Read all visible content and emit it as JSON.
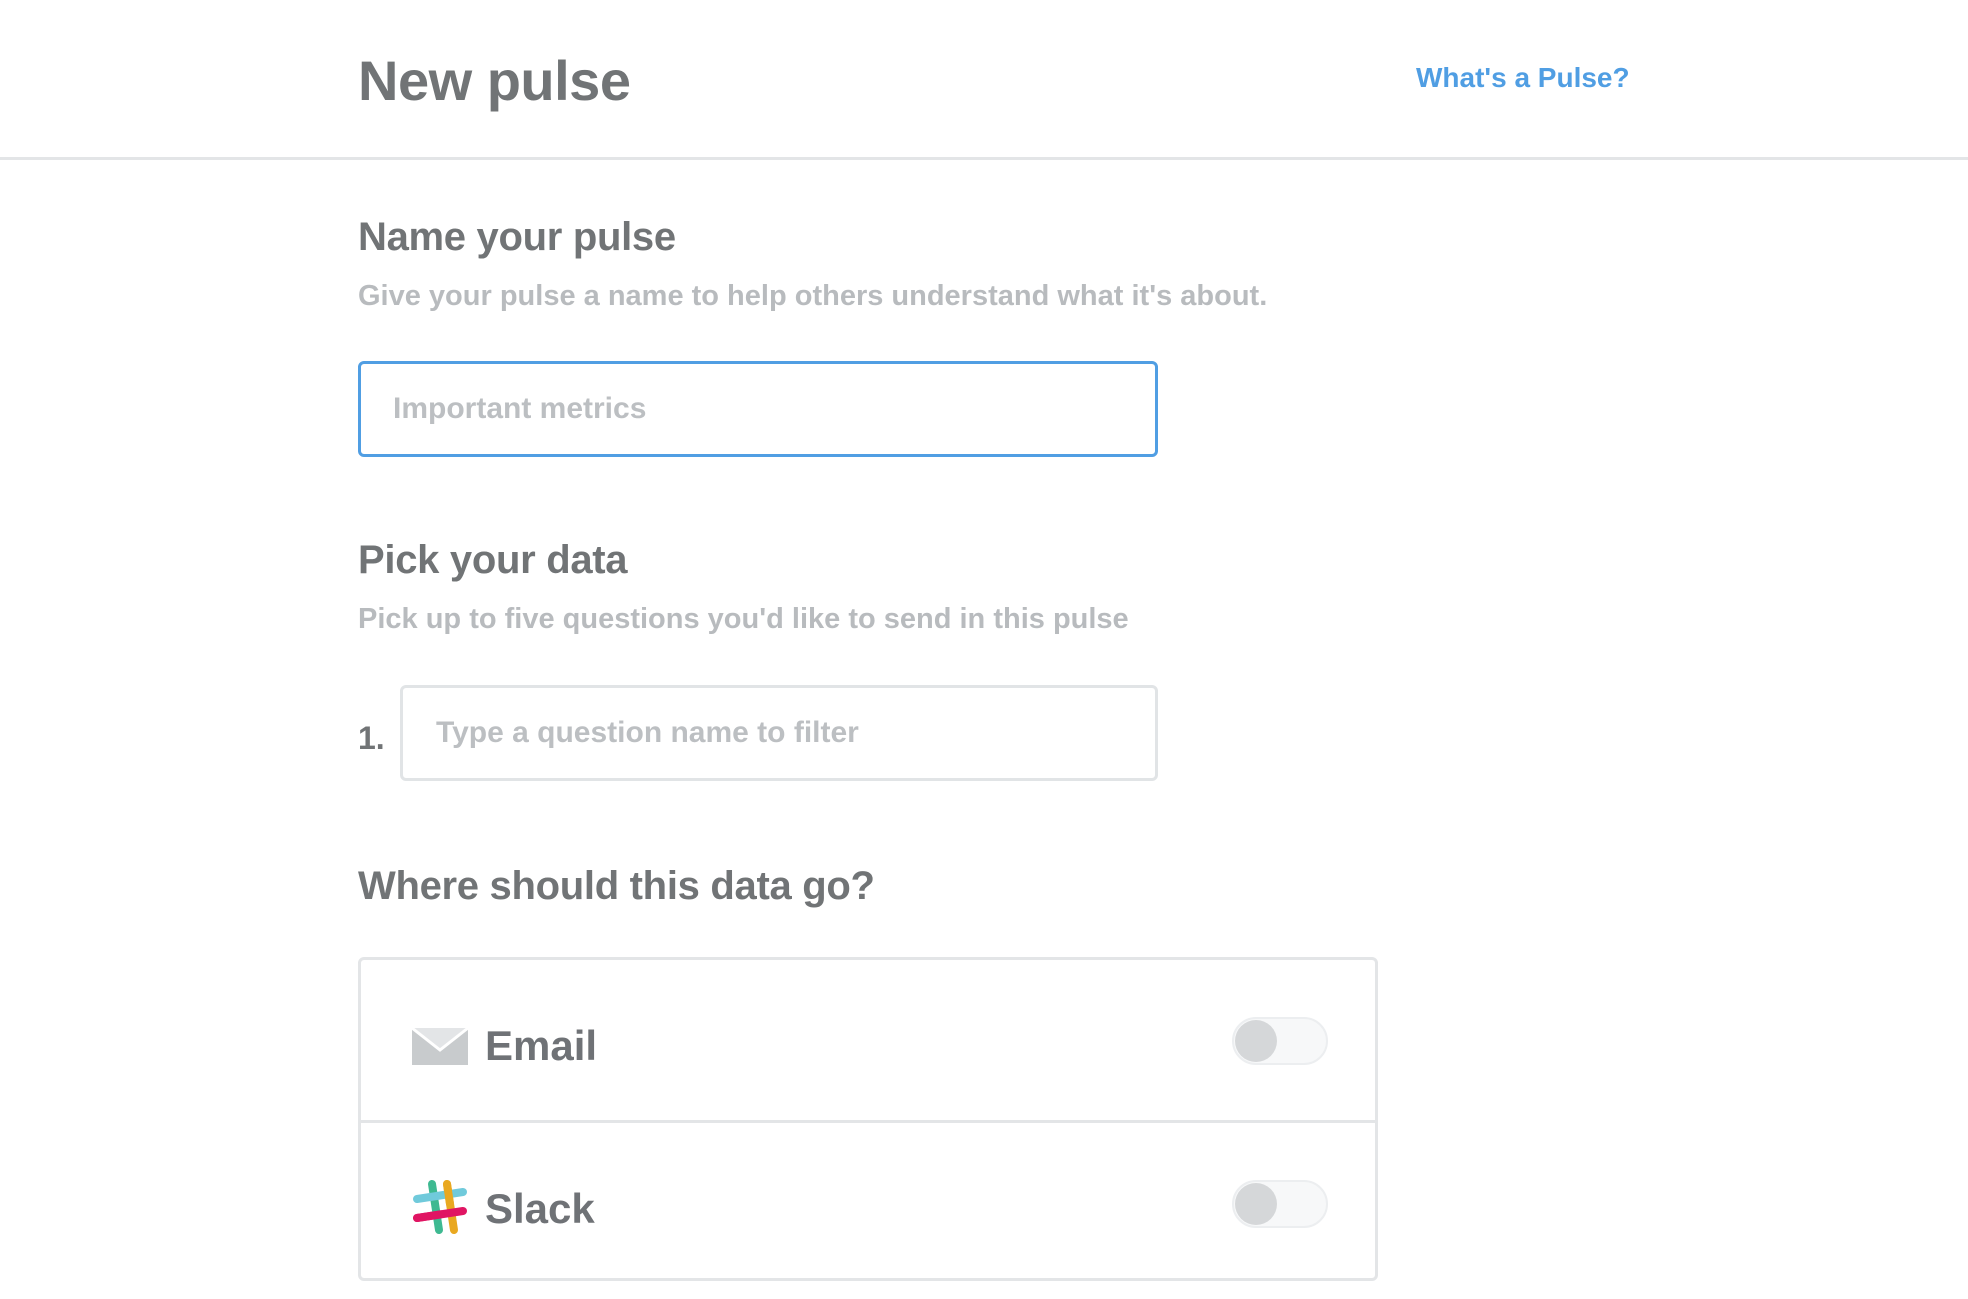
{
  "header": {
    "title": "New pulse",
    "help_link": "What's a Pulse?"
  },
  "name_section": {
    "title": "Name your pulse",
    "description": "Give your pulse a name to help others understand what it's about.",
    "input_placeholder": "Important metrics",
    "input_value": ""
  },
  "data_section": {
    "title": "Pick your data",
    "description": "Pick up to five questions you'd like to send in this pulse",
    "items": [
      {
        "number": "1.",
        "placeholder": "Type a question name to filter",
        "value": ""
      }
    ]
  },
  "destination_section": {
    "title": "Where should this data go?",
    "channels": [
      {
        "label": "Email",
        "icon": "envelope-icon",
        "enabled": false
      },
      {
        "label": "Slack",
        "icon": "slack-logo-icon",
        "enabled": false
      }
    ]
  },
  "colors": {
    "brand_blue": "#509ee3",
    "text": "#717476",
    "muted_text": "#b8bbbe",
    "border": "#e3e5e7"
  }
}
